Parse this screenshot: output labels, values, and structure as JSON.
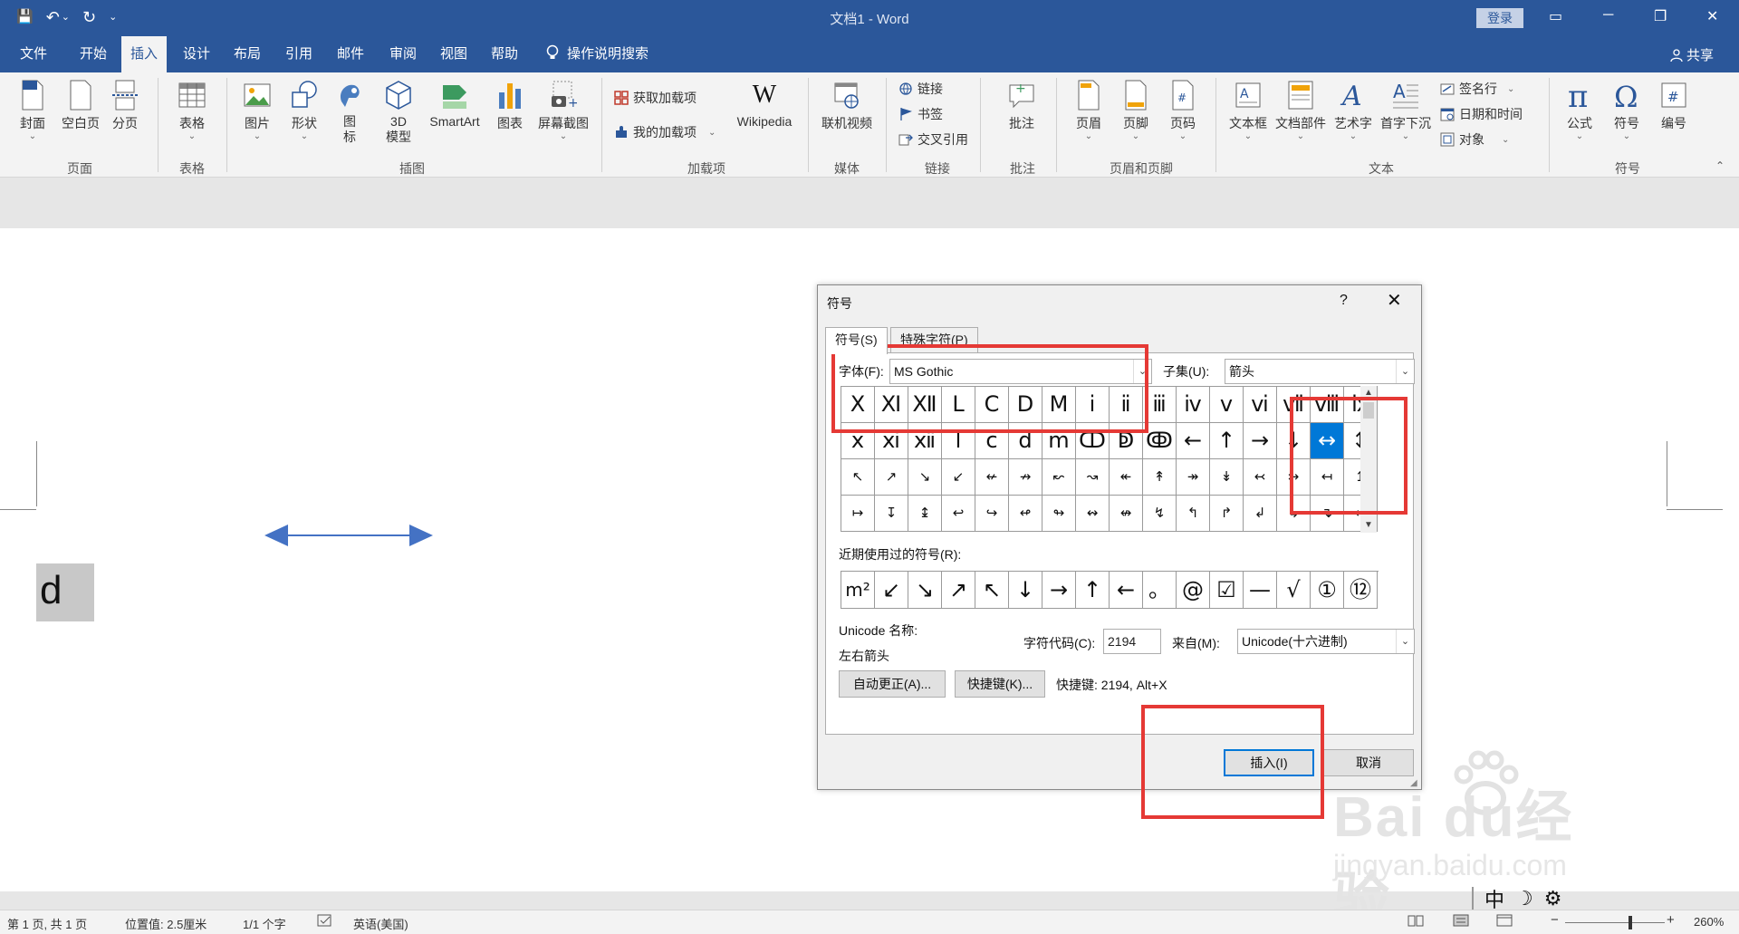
{
  "window": {
    "title": "文档1  -  Word",
    "login": "登录",
    "qat": {
      "save": "💾",
      "undo": "↶",
      "undo_caret": "⌄",
      "redo": "↻",
      "customize": "⌄"
    },
    "controls": {
      "ribbon_display": "▭",
      "minimize": "─",
      "restore": "❐",
      "close": "✕"
    }
  },
  "tabs": [
    "文件",
    "开始",
    "插入",
    "设计",
    "布局",
    "引用",
    "邮件",
    "审阅",
    "视图",
    "帮助"
  ],
  "tell_me": "操作说明搜索",
  "share": "共享",
  "ribbon": {
    "page_group": {
      "label": "页面",
      "items": [
        "封面",
        "空白页",
        "分页"
      ]
    },
    "table_group": {
      "label": "表格",
      "items": [
        "表格"
      ]
    },
    "illus_group": {
      "label": "插图",
      "items": [
        "图片",
        "形状",
        "图标",
        "3D模型",
        "SmartArt",
        "图表",
        "屏幕截图"
      ],
      "icon_line1": "图",
      "icon_line2": "标",
      "model_line1": "3D",
      "model_line2": "模型"
    },
    "addins_group": {
      "label": "加载项",
      "get": "获取加载项",
      "mine": "我的加载项",
      "wiki_logo": "W",
      "wiki": "Wikipedia"
    },
    "media_group": {
      "label": "媒体",
      "items": [
        "联机视频"
      ]
    },
    "links_group": {
      "label": "链接",
      "items": [
        "链接",
        "书签",
        "交叉引用"
      ]
    },
    "comments_group": {
      "label": "批注",
      "items": [
        "批注"
      ]
    },
    "hf_group": {
      "label": "页眉和页脚",
      "items": [
        "页眉",
        "页脚",
        "页码"
      ]
    },
    "text_group": {
      "label": "文本",
      "items": [
        "文本框",
        "文档部件",
        "艺术字",
        "首字下沉"
      ],
      "small": [
        "签名行",
        "日期和时间",
        "对象"
      ]
    },
    "symbols_group": {
      "label": "符号",
      "items": [
        "公式",
        "符号",
        "编号"
      ]
    },
    "collapse": "⌃"
  },
  "document": {
    "selected_text": "d"
  },
  "dialog": {
    "title": "符号",
    "help": "?",
    "close": "✕",
    "tabs": [
      "符号(S)",
      "特殊字符(P)"
    ],
    "font_label": "字体(F):",
    "font_value": "MS Gothic",
    "subset_label": "子集(U):",
    "subset_value": "箭头",
    "grid": [
      [
        "Ⅹ",
        "Ⅺ",
        "Ⅻ",
        "Ⅼ",
        "Ⅽ",
        "Ⅾ",
        "Ⅿ",
        "ⅰ",
        "ⅱ",
        "ⅲ",
        "ⅳ",
        "ⅴ",
        "ⅵ",
        "ⅶ",
        "ⅷ",
        "ⅸ"
      ],
      [
        "ⅹ",
        "ⅺ",
        "ⅻ",
        "ⅼ",
        "ⅽ",
        "ⅾ",
        "ⅿ",
        "ↀ",
        "ↁ",
        "ↂ",
        "←",
        "↑",
        "→",
        "↓",
        "↔",
        "↕"
      ],
      [
        "↖",
        "↗",
        "↘",
        "↙",
        "↚",
        "↛",
        "↜",
        "↝",
        "↞",
        "↟",
        "↠",
        "↡",
        "↢",
        "↣",
        "↤",
        "↥"
      ],
      [
        "↦",
        "↧",
        "↨",
        "↩",
        "↪",
        "↫",
        "↬",
        "↭",
        "↮",
        "↯",
        "↰",
        "↱",
        "↲",
        "↳",
        "↴",
        "↵"
      ]
    ],
    "selected_cell": [
      1,
      14
    ],
    "recent_label": "近期使用过的符号(R):",
    "recent": [
      "m²",
      "↙",
      "↘",
      "↗",
      "↖",
      "↓",
      "→",
      "↑",
      "←",
      "。",
      "@",
      "☑",
      "—",
      "√",
      "①",
      "⑫"
    ],
    "unicode_name_label": "Unicode 名称:",
    "unicode_name": "左右箭头",
    "char_code_label": "字符代码(C):",
    "char_code": "2194",
    "from_label": "来自(M):",
    "from_value": "Unicode(十六进制)",
    "autocorrect": "自动更正(A)...",
    "shortcut_btn": "快捷键(K)...",
    "shortcut_text": "快捷键: 2194, Alt+X",
    "insert": "插入(I)",
    "cancel": "取消"
  },
  "statusbar": {
    "page": "第 1 页, 共 1 页",
    "position": "位置值: 2.5厘米",
    "words": "1/1 个字",
    "language": "英语(美国)",
    "zoom": "260%",
    "zoom_minus": "−",
    "zoom_plus": "+"
  },
  "ime": {
    "mode": "中",
    "moon": "☽",
    "gear": "⚙"
  },
  "watermark": {
    "brand": "Bai du经验",
    "url": "jingyan.baidu.com"
  },
  "colors": {
    "brand": "#2b579a",
    "selection": "#0078d7",
    "highlight": "#e53935",
    "arrow": "#4472c4"
  }
}
